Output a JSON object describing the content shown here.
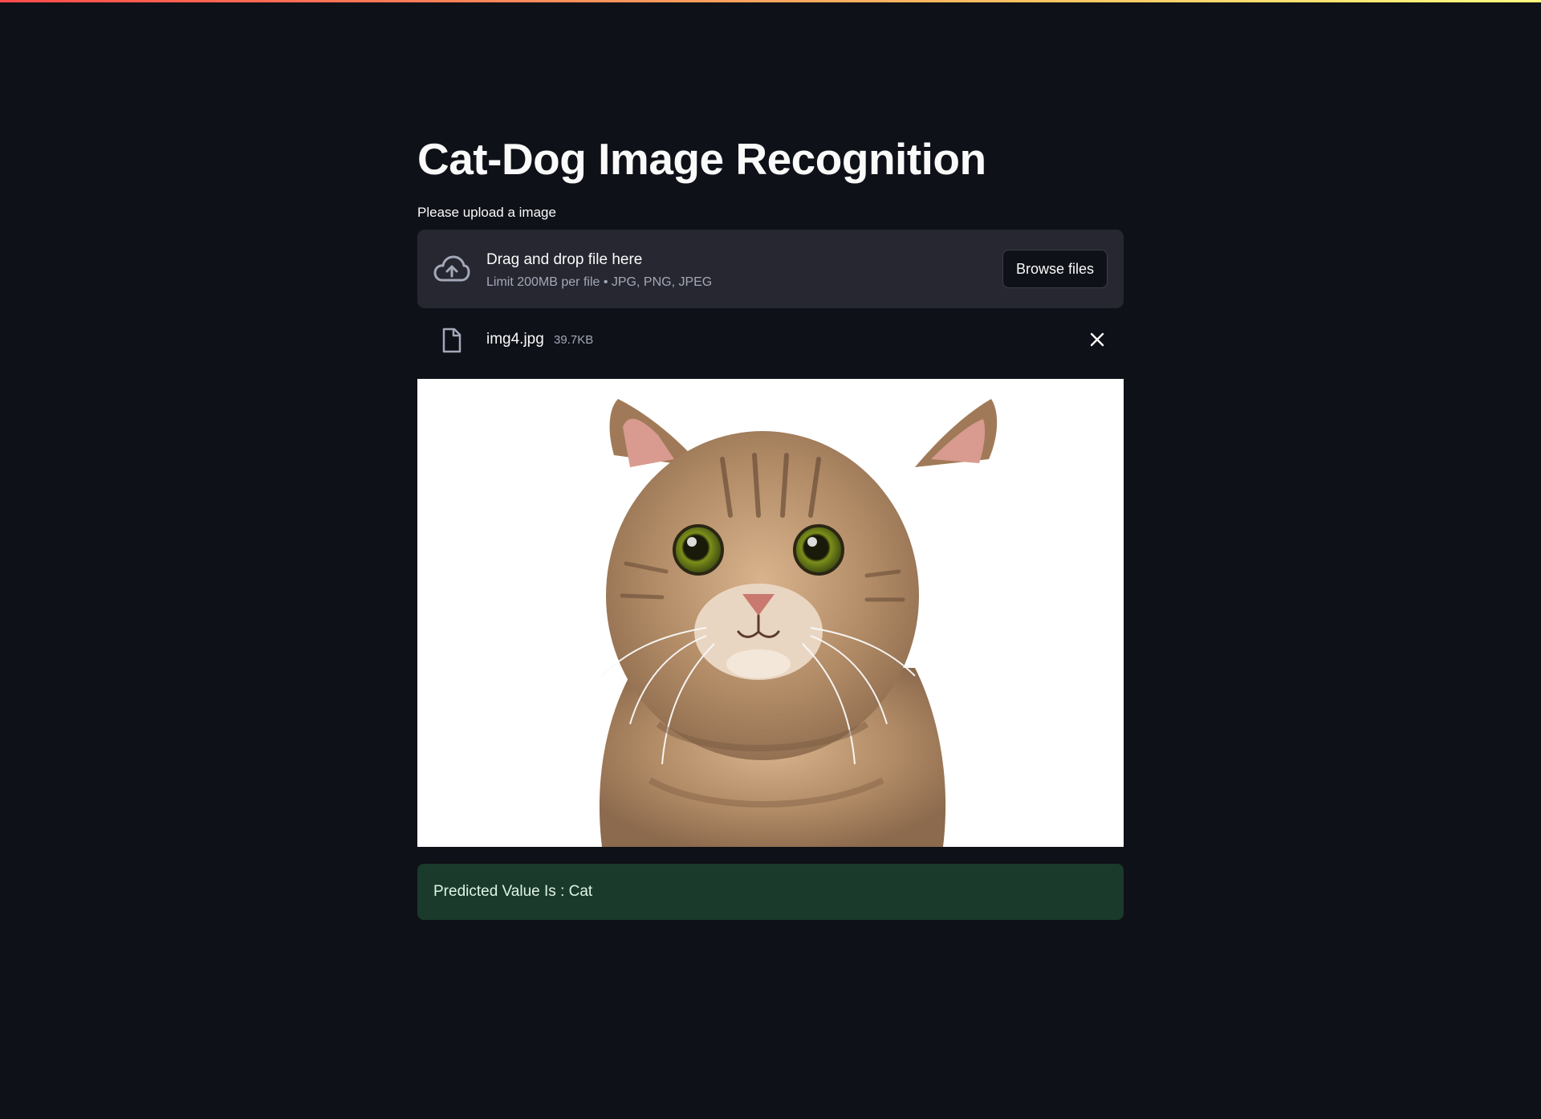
{
  "app": {
    "title": "Cat-Dog Image Recognition",
    "accent_gradient": [
      "#ff4b4b",
      "#ffc862",
      "#fffd80"
    ],
    "background": "#0e1117"
  },
  "uploader": {
    "label": "Please upload a image",
    "drop_text": "Drag and drop file here",
    "limit_text": "Limit 200MB per file • JPG, PNG, JPEG",
    "browse_label": "Browse files",
    "icon": "cloud-upload-icon"
  },
  "uploaded_file": {
    "name": "img4.jpg",
    "size": "39.7KB",
    "icon": "file-icon",
    "remove_icon": "close-icon"
  },
  "preview": {
    "subject": "cat",
    "background": "#ffffff"
  },
  "result": {
    "text": "Predicted Value Is : Cat",
    "background": "#1a3a2b"
  }
}
